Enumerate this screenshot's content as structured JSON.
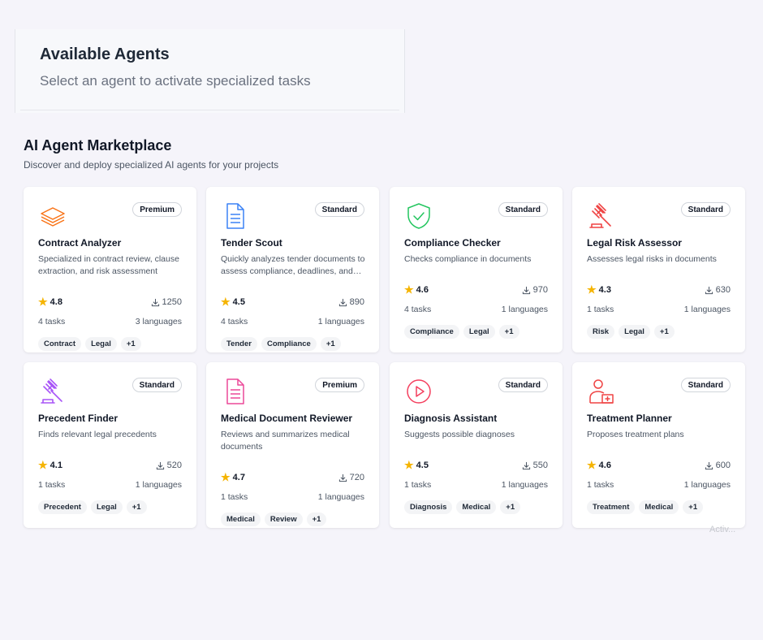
{
  "header_panel": {
    "title": "Available Agents",
    "subtitle": "Select an agent to activate specialized tasks"
  },
  "marketplace": {
    "title": "AI Agent Marketplace",
    "subtitle": "Discover and deploy specialized AI agents for your projects"
  },
  "agents": [
    {
      "name": "Contract Analyzer",
      "badge": "Premium",
      "icon": "layers-icon",
      "color": "#f97316",
      "description": "Specialized in contract review, clause extraction, and risk assessment",
      "rating": "4.8",
      "downloads": "1250",
      "tasks": "4 tasks",
      "languages": "3 languages",
      "tags": [
        "Contract",
        "Legal",
        "+1"
      ]
    },
    {
      "name": "Tender Scout",
      "badge": "Standard",
      "icon": "document-icon",
      "color": "#3b82f6",
      "description": "Quickly analyzes tender documents to assess compliance, deadlines, and requirements",
      "rating": "4.5",
      "downloads": "890",
      "tasks": "4 tasks",
      "languages": "1 languages",
      "tags": [
        "Tender",
        "Compliance",
        "+1"
      ]
    },
    {
      "name": "Compliance Checker",
      "badge": "Standard",
      "icon": "shield-check-icon",
      "color": "#22c55e",
      "description": "Checks compliance in documents",
      "rating": "4.6",
      "downloads": "970",
      "tasks": "4 tasks",
      "languages": "1 languages",
      "tags": [
        "Compliance",
        "Legal",
        "+1"
      ]
    },
    {
      "name": "Legal Risk Assessor",
      "badge": "Standard",
      "icon": "gavel-icon",
      "color": "#ef4444",
      "description": "Assesses legal risks in documents",
      "rating": "4.3",
      "downloads": "630",
      "tasks": "1 tasks",
      "languages": "1 languages",
      "tags": [
        "Risk",
        "Legal",
        "+1"
      ]
    },
    {
      "name": "Precedent Finder",
      "badge": "Standard",
      "icon": "gavel-icon",
      "color": "#a855f7",
      "description": "Finds relevant legal precedents",
      "rating": "4.1",
      "downloads": "520",
      "tasks": "1 tasks",
      "languages": "1 languages",
      "tags": [
        "Precedent",
        "Legal",
        "+1"
      ]
    },
    {
      "name": "Medical Document Reviewer",
      "badge": "Premium",
      "icon": "document-icon",
      "color": "#ec4899",
      "description": "Reviews and summarizes medical documents",
      "rating": "4.7",
      "downloads": "720",
      "tasks": "1 tasks",
      "languages": "1 languages",
      "tags": [
        "Medical",
        "Review",
        "+1"
      ]
    },
    {
      "name": "Diagnosis Assistant",
      "badge": "Standard",
      "icon": "play-circle-icon",
      "color": "#f43f5e",
      "description": "Suggests possible diagnoses",
      "rating": "4.5",
      "downloads": "550",
      "tasks": "1 tasks",
      "languages": "1 languages",
      "tags": [
        "Diagnosis",
        "Medical",
        "+1"
      ]
    },
    {
      "name": "Treatment Planner",
      "badge": "Standard",
      "icon": "user-hospital-icon",
      "color": "#ef4444",
      "description": "Proposes treatment plans",
      "rating": "4.6",
      "downloads": "600",
      "tasks": "1 tasks",
      "languages": "1 languages",
      "tags": [
        "Treatment",
        "Medical",
        "+1"
      ]
    }
  ],
  "faded_label": "Activ..."
}
